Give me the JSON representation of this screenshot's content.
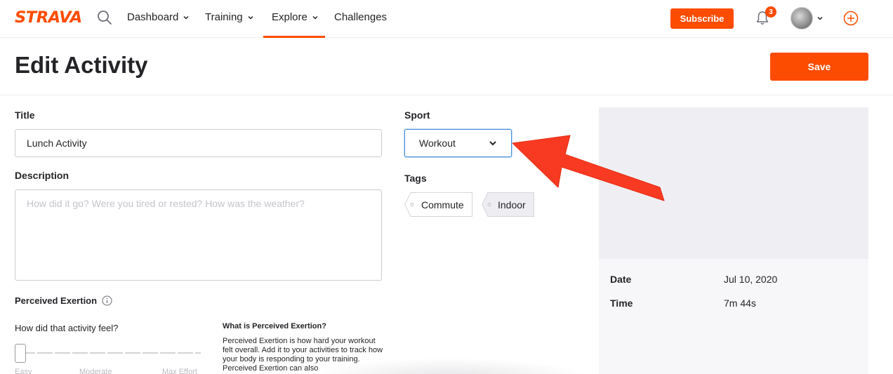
{
  "nav": {
    "logo": "STRAVA",
    "items": [
      {
        "label": "Dashboard"
      },
      {
        "label": "Training"
      },
      {
        "label": "Explore"
      },
      {
        "label": "Challenges"
      }
    ],
    "subscribe_label": "Subscribe",
    "notification_count": "3",
    "search_icon": "search-icon",
    "bell_icon": "bell-icon",
    "plus_icon": "plus-circle-icon"
  },
  "header": {
    "title": "Edit Activity",
    "save_label": "Save"
  },
  "form": {
    "title_label": "Title",
    "title_value": "Lunch Activity",
    "description_label": "Description",
    "description_placeholder": "How did it go? Were you tired or rested? How was the weather?",
    "perceived_exertion_label": "Perceived Exertion",
    "feel_question": "How did that activity feel?",
    "scale": {
      "easy": "Easy",
      "moderate": "Moderate",
      "max": "Max Effort"
    },
    "pe_info_title": "What is Perceived Exertion?",
    "pe_info_body": "Perceived Exertion is how hard your workout felt overall. Add it to your activities to track how your body is responding to your training. Perceived Exertion can also",
    "sport_label": "Sport",
    "sport_value": "Workout",
    "tags_label": "Tags",
    "tags": [
      {
        "label": "Commute",
        "selected": false
      },
      {
        "label": "Indoor",
        "selected": true
      }
    ]
  },
  "stats": {
    "date_label": "Date",
    "date_value": "Jul 10, 2020",
    "time_label": "Time",
    "time_value": "7m 44s"
  },
  "colors": {
    "brand": "#fc4c02",
    "annotation_arrow": "#f93a22"
  }
}
